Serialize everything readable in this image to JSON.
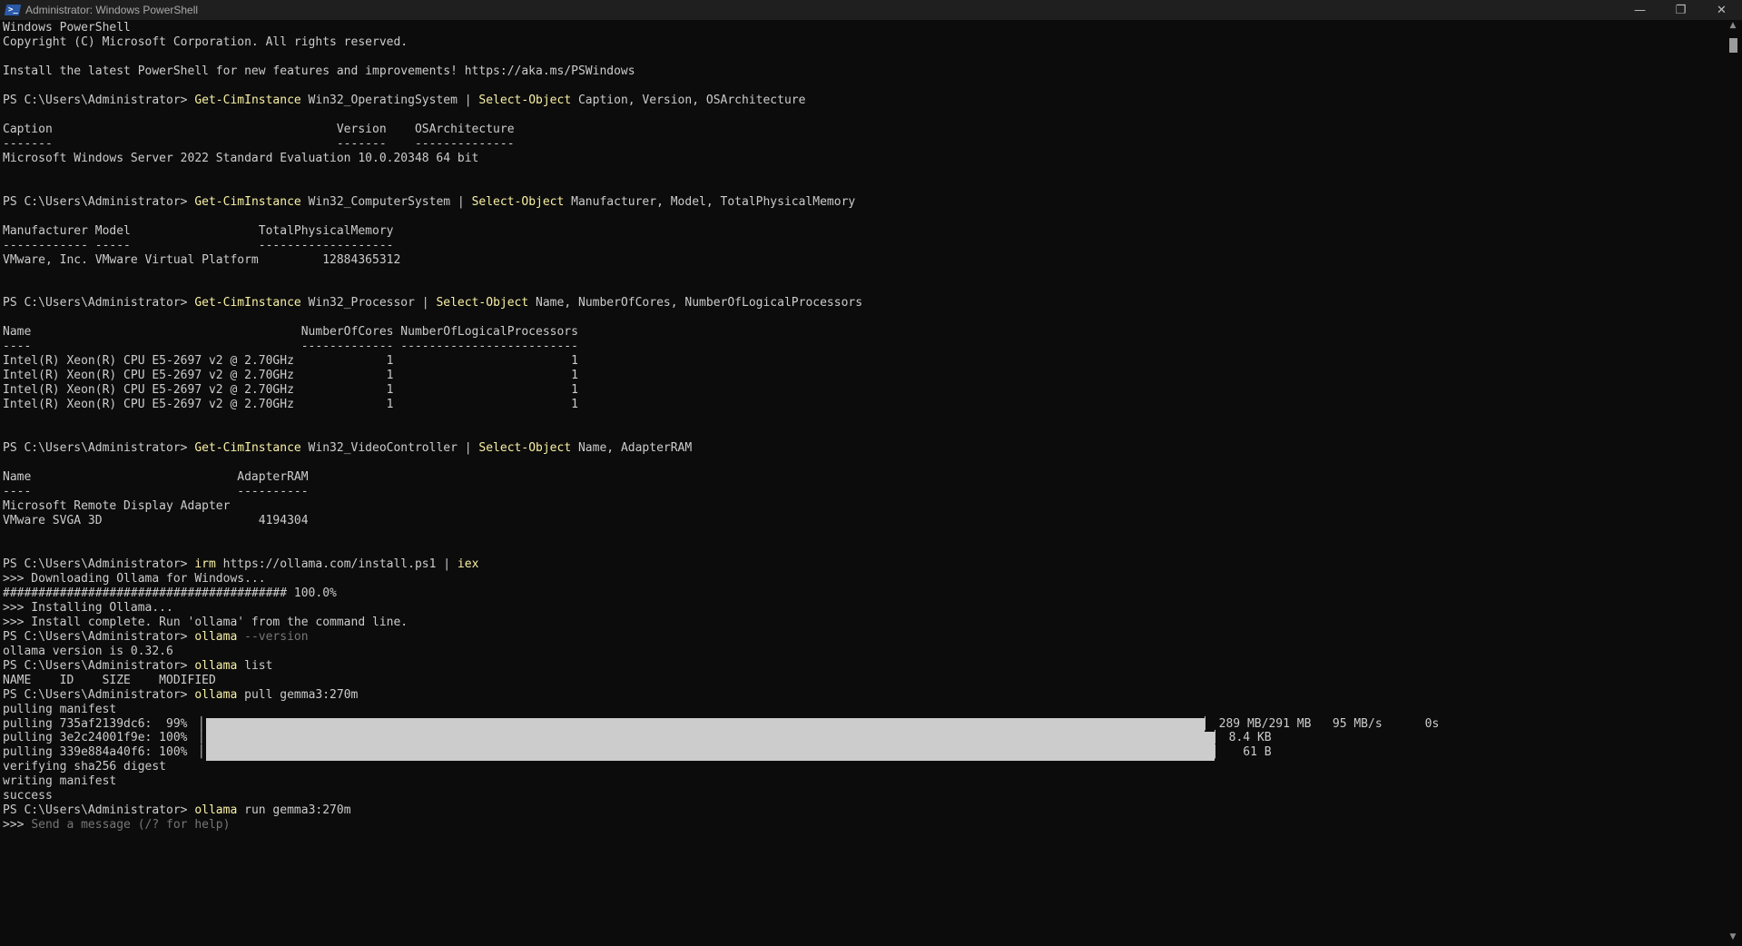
{
  "window": {
    "title": "Administrator: Windows PowerShell",
    "logo_glyph": ">_",
    "minimize_glyph": "—",
    "restore_glyph": "❐",
    "close_glyph": "✕"
  },
  "terminal": {
    "lines": [
      {
        "t": "Windows PowerShell"
      },
      {
        "t": "Copyright (C) Microsoft Corporation. All rights reserved."
      },
      {
        "t": ""
      },
      {
        "t": "Install the latest PowerShell for new features and improvements! https://aka.ms/PSWindows"
      },
      {
        "t": ""
      },
      {
        "prompt": "PS C:\\Users\\Administrator> ",
        "parts": [
          {
            "c": "cmd",
            "t": "Get-CimInstance"
          },
          {
            "t": " Win32_OperatingSystem | "
          },
          {
            "c": "cmd",
            "t": "Select-Object"
          },
          {
            "t": " Caption, Version, OSArchitecture"
          }
        ]
      },
      {
        "t": ""
      },
      {
        "t": "Caption                                        Version    OSArchitecture"
      },
      {
        "t": "-------                                        -------    --------------"
      },
      {
        "t": "Microsoft Windows Server 2022 Standard Evaluation 10.0.20348 64 bit"
      },
      {
        "t": ""
      },
      {
        "t": ""
      },
      {
        "prompt": "PS C:\\Users\\Administrator> ",
        "parts": [
          {
            "c": "cmd",
            "t": "Get-CimInstance"
          },
          {
            "t": " Win32_ComputerSystem | "
          },
          {
            "c": "cmd",
            "t": "Select-Object"
          },
          {
            "t": " Manufacturer, Model, TotalPhysicalMemory"
          }
        ]
      },
      {
        "t": ""
      },
      {
        "t": "Manufacturer Model                  TotalPhysicalMemory"
      },
      {
        "t": "------------ -----                  -------------------"
      },
      {
        "t": "VMware, Inc. VMware Virtual Platform         12884365312"
      },
      {
        "t": ""
      },
      {
        "t": ""
      },
      {
        "prompt": "PS C:\\Users\\Administrator> ",
        "parts": [
          {
            "c": "cmd",
            "t": "Get-CimInstance"
          },
          {
            "t": " Win32_Processor | "
          },
          {
            "c": "cmd",
            "t": "Select-Object"
          },
          {
            "t": " Name, NumberOfCores, NumberOfLogicalProcessors"
          }
        ]
      },
      {
        "t": ""
      },
      {
        "t": "Name                                      NumberOfCores NumberOfLogicalProcessors"
      },
      {
        "t": "----                                      ------------- -------------------------"
      },
      {
        "t": "Intel(R) Xeon(R) CPU E5-2697 v2 @ 2.70GHz             1                         1"
      },
      {
        "t": "Intel(R) Xeon(R) CPU E5-2697 v2 @ 2.70GHz             1                         1"
      },
      {
        "t": "Intel(R) Xeon(R) CPU E5-2697 v2 @ 2.70GHz             1                         1"
      },
      {
        "t": "Intel(R) Xeon(R) CPU E5-2697 v2 @ 2.70GHz             1                         1"
      },
      {
        "t": ""
      },
      {
        "t": ""
      },
      {
        "prompt": "PS C:\\Users\\Administrator> ",
        "parts": [
          {
            "c": "cmd",
            "t": "Get-CimInstance"
          },
          {
            "t": " Win32_VideoController | "
          },
          {
            "c": "cmd",
            "t": "Select-Object"
          },
          {
            "t": " Name, AdapterRAM"
          }
        ]
      },
      {
        "t": ""
      },
      {
        "t": "Name                             AdapterRAM"
      },
      {
        "t": "----                             ----------"
      },
      {
        "t": "Microsoft Remote Display Adapter"
      },
      {
        "t": "VMware SVGA 3D                      4194304"
      },
      {
        "t": ""
      },
      {
        "t": ""
      },
      {
        "prompt": "PS C:\\Users\\Administrator> ",
        "parts": [
          {
            "c": "cmd",
            "t": "irm"
          },
          {
            "t": " https://ollama.com/install.ps1 | "
          },
          {
            "c": "cmd",
            "t": "iex"
          }
        ]
      },
      {
        "t": ">>> Downloading Ollama for Windows..."
      },
      {
        "t": "######################################## 100.0%"
      },
      {
        "t": ">>> Installing Ollama..."
      },
      {
        "t": ">>> Install complete. Run 'ollama' from the command line."
      },
      {
        "prompt": "PS C:\\Users\\Administrator> ",
        "parts": [
          {
            "c": "cmd",
            "t": "ollama"
          },
          {
            "c": "flag",
            "t": " --version"
          }
        ]
      },
      {
        "t": "ollama version is 0.32.6"
      },
      {
        "prompt": "PS C:\\Users\\Administrator> ",
        "parts": [
          {
            "c": "cmd",
            "t": "ollama"
          },
          {
            "t": " list"
          }
        ]
      },
      {
        "t": "NAME    ID    SIZE    MODIFIED"
      },
      {
        "prompt": "PS C:\\Users\\Administrator> ",
        "parts": [
          {
            "c": "cmd",
            "t": "ollama"
          },
          {
            "t": " pull gemma3:270m"
          }
        ]
      },
      {
        "t": "pulling manifest"
      },
      {
        "progress": {
          "label": "pulling 735af2139dc6:  99% ▕",
          "fraction": 0.99,
          "stats": "▏ 289 MB/291 MB   95 MB/s      0s"
        }
      },
      {
        "progress": {
          "label": "pulling 3e2c24001f9e: 100% ▕",
          "fraction": 1.0,
          "stats": "▏ 8.4 KB"
        }
      },
      {
        "progress": {
          "label": "pulling 339e884a40f6: 100% ▕",
          "fraction": 1.0,
          "stats": "▏   61 B"
        }
      },
      {
        "t": "verifying sha256 digest"
      },
      {
        "t": "writing manifest"
      },
      {
        "t": "success"
      },
      {
        "prompt": "PS C:\\Users\\Administrator> ",
        "parts": [
          {
            "c": "cmd",
            "t": "ollama"
          },
          {
            "t": " run gemma3:270m"
          }
        ]
      },
      {
        "prompt": ">>> ",
        "parts": [
          {
            "c": "hint",
            "t": "Send a message (/? for help)"
          }
        ]
      }
    ]
  },
  "scrollbar": {
    "up_glyph": "▲",
    "down_glyph": "▼"
  }
}
